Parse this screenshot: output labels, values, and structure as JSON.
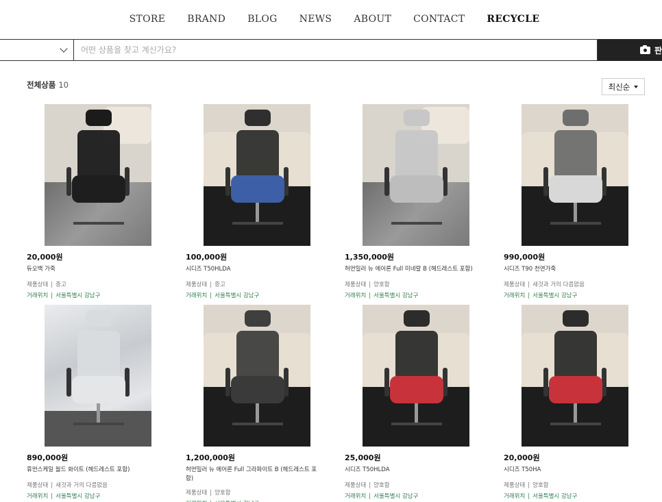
{
  "nav": {
    "items": [
      {
        "label": "STORE",
        "active": false
      },
      {
        "label": "BRAND",
        "active": false
      },
      {
        "label": "BLOG",
        "active": false
      },
      {
        "label": "NEWS",
        "active": false
      },
      {
        "label": "ABOUT",
        "active": false
      },
      {
        "label": "CONTACT",
        "active": false
      },
      {
        "label": "RECYCLE",
        "active": true
      }
    ]
  },
  "search": {
    "placeholder": "어떤 상품을 찾고 계신가요?",
    "camera_label": "판",
    "category_icon": "chevron-down-icon",
    "camera_icon": "camera-icon"
  },
  "list": {
    "title": "전체상품",
    "count": "10",
    "sort_label": "최신순",
    "sort_icon": "caret-down-icon"
  },
  "products": [
    {
      "price": "20,000원",
      "name": "듀오백 가죽",
      "condition_label": "제품상태",
      "condition": "중고",
      "location_label": "거래위치",
      "location": "서울특별시 강남구",
      "seat_color": "#1e1e1e",
      "back_color": "#1b1b1b",
      "bg": "tile"
    },
    {
      "price": "100,000원",
      "name": "시디즈 T50HLDA",
      "condition_label": "제품상태",
      "condition": "중고",
      "location_label": "거래위치",
      "location": "서울특별시 강남구",
      "seat_color": "#3c5fa8",
      "back_color": "#2f2f2f",
      "bg": "rug"
    },
    {
      "price": "1,350,000원",
      "name": "허먼밀러 뉴 에어론 Full 미네랄 B (헤드레스트 포함)",
      "condition_label": "제품상태",
      "condition": "양호함",
      "location_label": "거래위치",
      "location": "서울특별시 강남구",
      "seat_color": "#bdbdbd",
      "back_color": "#c7c7c7",
      "bg": "tile"
    },
    {
      "price": "990,000원",
      "name": "시디즈 T90 천연가죽",
      "condition_label": "제품상태",
      "condition": "새것과 거의 다름없음",
      "location_label": "거래위치",
      "location": "서울특별시 강남구",
      "seat_color": "#d8d8d8",
      "back_color": "#6e6e6e",
      "bg": "rug"
    },
    {
      "price": "890,000원",
      "name": "휴먼스케일 월드 화이트 (헤드레스트 포함)",
      "condition_label": "제품상태",
      "condition": "새것과 거의 다름없음",
      "location_label": "거래위치",
      "location": "서울특별시 강남구",
      "seat_color": "#e4e6e8",
      "back_color": "#d9dcdf",
      "bg": "wrap"
    },
    {
      "price": "1,200,000원",
      "name": "허먼밀러 뉴 에어론 Full 그라파이트 B (헤드레스트 포함)",
      "condition_label": "제품상태",
      "condition": "양호함",
      "location_label": "거래위치",
      "location": "서울특별시 강남구",
      "seat_color": "#3a3a3a",
      "back_color": "#3f3f3f",
      "bg": "rug"
    },
    {
      "price": "25,000원",
      "name": "시디즈 T50HLDA",
      "condition_label": "제품상태",
      "condition": "양호함",
      "location_label": "거래위치",
      "location": "서울특별시 강남구",
      "seat_color": "#c8323a",
      "back_color": "#2c2c2c",
      "bg": "rug"
    },
    {
      "price": "20,000원",
      "name": "시디즈 T50HA",
      "condition_label": "제품상태",
      "condition": "양호함",
      "location_label": "거래위치",
      "location": "서울특별시 강남구",
      "seat_color": "#c8323a",
      "back_color": "#2c2c2c",
      "bg": "rug"
    }
  ]
}
